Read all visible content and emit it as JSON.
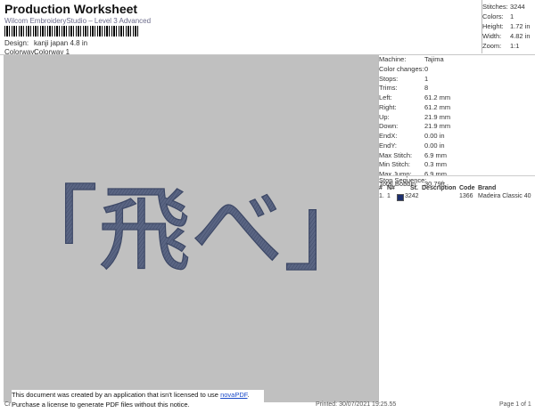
{
  "header": {
    "title": "Production Worksheet",
    "software": "Wilcom EmbroideryStudio – Level 3 Advanced",
    "design_label": "Design:",
    "design_value": "kanji japan 4.8 in",
    "colorway_label": "Colorway:",
    "colorway_value": "Colorway 1"
  },
  "stats": [
    {
      "k": "Stitches:",
      "v": "3244"
    },
    {
      "k": "Colors:",
      "v": "1"
    },
    {
      "k": "Height:",
      "v": "1.72 in"
    },
    {
      "k": "Width:",
      "v": "4.82 in"
    },
    {
      "k": "Zoom:",
      "v": "1:1"
    }
  ],
  "machine_info": [
    {
      "k": "Machine:",
      "v": "Tajima"
    },
    {
      "k": "Color changes:",
      "v": "0"
    },
    {
      "k": "Stops:",
      "v": "1"
    },
    {
      "k": "Trims:",
      "v": "8"
    },
    {
      "k": "Left:",
      "v": "61.2 mm"
    },
    {
      "k": "Right:",
      "v": "61.2 mm"
    },
    {
      "k": "Up:",
      "v": "21.9 mm"
    },
    {
      "k": "Down:",
      "v": "21.9 mm"
    },
    {
      "k": "EndX:",
      "v": "0.00 in"
    },
    {
      "k": "EndY:",
      "v": "0.00 in"
    },
    {
      "k": "Max Stitch:",
      "v": "6.9 mm"
    },
    {
      "k": "Min Stitch:",
      "v": "0.3 mm"
    },
    {
      "k": "Max Jump:",
      "v": "6.9 mm"
    },
    {
      "k": "Total Bobbin:",
      "v": "30.79ft"
    }
  ],
  "stop_sequence": {
    "label": "Stop Sequence:",
    "headers": [
      "#",
      "N#",
      "St.",
      "Description",
      "Code",
      "Brand"
    ],
    "rows": [
      {
        "num": "1.",
        "n": "1",
        "st": "3242",
        "desc": "",
        "code": "1366",
        "brand": "Madeira Classic 40",
        "color": "#1d2f6e"
      }
    ]
  },
  "design": {
    "text": "「飛べ」",
    "thread_color": "#56617e"
  },
  "notice": {
    "line1_pre": "This document was created by an application that isn't licensed to use ",
    "link": "novaPDF",
    "line1_post": ".",
    "line2": "Purchase a license to generate PDF files without this notice."
  },
  "footer": {
    "left": "Cr",
    "printed": "Printed: 30/07/2021 19:25.55",
    "page": "Page 1 of 1"
  }
}
